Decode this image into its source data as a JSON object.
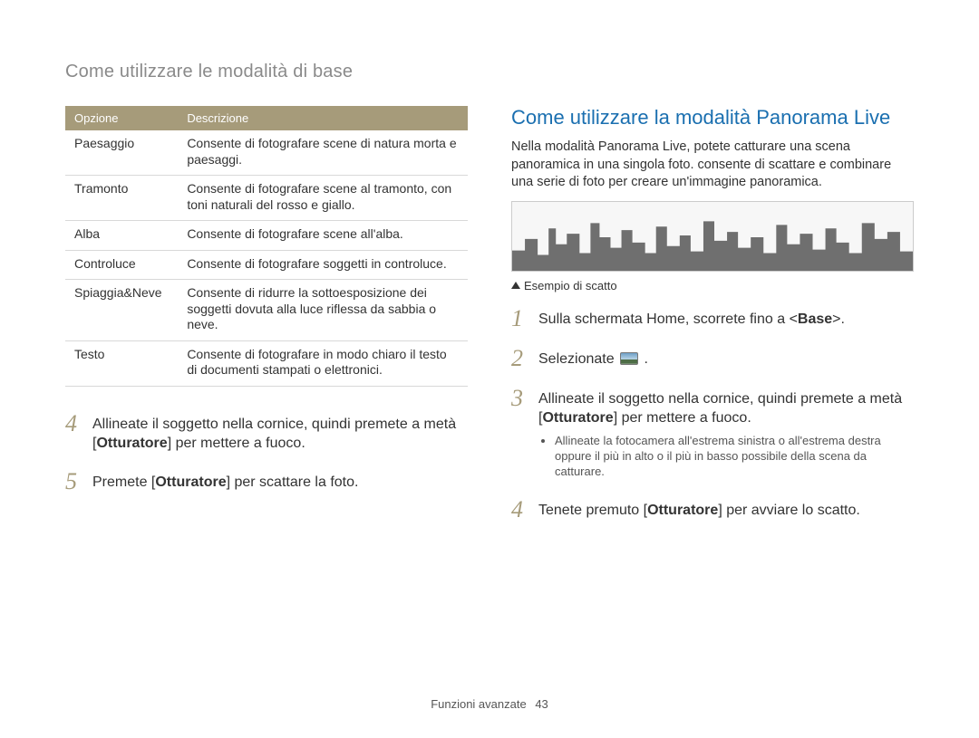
{
  "header": "Come utilizzare le modalità di base",
  "table": {
    "headers": {
      "option": "Opzione",
      "description": "Descrizione"
    },
    "rows": [
      {
        "option": "Paesaggio",
        "description": "Consente di fotografare scene di natura morta e paesaggi."
      },
      {
        "option": "Tramonto",
        "description": "Consente di fotografare scene al tramonto, con toni naturali del rosso e giallo."
      },
      {
        "option": "Alba",
        "description": "Consente di fotografare scene all'alba."
      },
      {
        "option": "Controluce",
        "description": "Consente di fotografare soggetti in controluce."
      },
      {
        "option": "Spiaggia&Neve",
        "description": "Consente di ridurre la sottoesposizione dei soggetti dovuta alla luce riflessa da sabbia o neve."
      },
      {
        "option": "Testo",
        "description": "Consente di fotografare in modo chiaro il testo di documenti stampati o elettronici."
      }
    ]
  },
  "left_steps": {
    "s4": {
      "num": "4",
      "pre": "Allineate il soggetto nella cornice, quindi premete a metà [",
      "bold": "Otturatore",
      "post": "] per mettere a fuoco."
    },
    "s5": {
      "num": "5",
      "pre": "Premete [",
      "bold": "Otturatore",
      "post": "] per scattare la foto."
    }
  },
  "right": {
    "title": "Come utilizzare la modalità Panorama Live",
    "intro": "Nella modalità Panorama Live, potete catturare una scena panoramica in una singola foto. consente di scattare e combinare una serie di foto per creare un'immagine panoramica.",
    "caption": "Esempio di scatto",
    "steps": {
      "s1": {
        "num": "1",
        "pre": "Sulla schermata Home, scorrete fino a <",
        "bold": "Base",
        "post": ">."
      },
      "s2": {
        "num": "2",
        "pre": "Selezionate ",
        "post": " ."
      },
      "s3": {
        "num": "3",
        "pre": "Allineate il soggetto nella cornice, quindi premete a metà [",
        "bold": "Otturatore",
        "post": "] per mettere a fuoco.",
        "bullet": "Allineate la fotocamera all'estrema sinistra o all'estrema destra oppure il più in alto o il più in basso possibile della scena da catturare."
      },
      "s4": {
        "num": "4",
        "pre": "Tenete premuto [",
        "bold": "Otturatore",
        "post": "] per avviare lo scatto."
      }
    }
  },
  "footer": {
    "label": "Funzioni avanzate",
    "page": "43"
  }
}
